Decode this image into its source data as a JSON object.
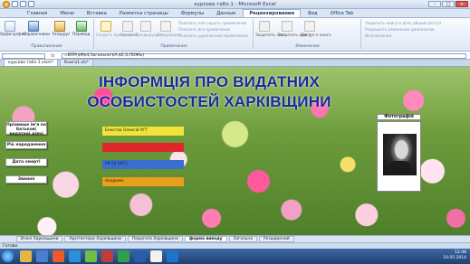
{
  "window": {
    "title": "курсова табл.1 - Microsoft Excel"
  },
  "ribbon_tabs": [
    "Главная",
    "Меню",
    "Вставка",
    "Разметка страницы",
    "Формулы",
    "Данные",
    "Рецензирование",
    "Вид",
    "Office Tab"
  ],
  "active_tab_index": 6,
  "ribbon": {
    "spelling": "Орфография",
    "research": "Справочники",
    "thesaurus": "Тезаурус",
    "translate": "Перевод",
    "proofing_group": "Правописание",
    "comments_group": "Примечания",
    "changes_group": "Изменения",
    "create_note": "Создать примечание",
    "delete": "Удалить",
    "previous": "Предыдущее",
    "next": "Следующее",
    "show_hide": "Показать или скрыть примечание",
    "show_all": "Показать все примечания",
    "show_ink": "Показать рукописные примечания",
    "protect_sheet": "Защитить лист",
    "protect_book": "Защитить книгу",
    "share_book": "Доступ к книге",
    "protect_share": "Защитить книгу и дать общий доступ",
    "allow_ranges": "Разрешить изменение диапазонов",
    "track": "Исправления"
  },
  "formula_bar": {
    "name_box": "",
    "fx": "fx",
    "formula": "=ВПР($M$4;Загальна!$A:$E;3;ЛОЖЬ)"
  },
  "doc_tabs": [
    "курсова табл.1.xlsm*",
    "Книга1.xls*"
  ],
  "active_doc_tab": 0,
  "sheet": {
    "title": "ІНФОРМЦІЯ ПРО ВИДАТНИХ ОСОБИСТОСТЕЙ ХАРКІВЩИНИ",
    "buttons": [
      "Прізвище ім'я по батькові видатної діячі",
      "Рік народження",
      "Дата смерті",
      "Звання"
    ],
    "bars": [
      {
        "text": "Бекетов Олексій М'Т",
        "color": "#f2e33a"
      },
      {
        "text": "",
        "color": "#e0262b"
      },
      {
        "text": "09.02.1871",
        "color": "#3a6fd1"
      },
      {
        "text": "Академік",
        "color": "#e8a01b"
      }
    ],
    "photo_label": "Фотографія"
  },
  "sheet_tabs": [
    "Вчені Харківщини",
    "Архітектори Харківщини",
    "Педагоги Харківщини",
    "форма виводу",
    "Загальна",
    "Розширений"
  ],
  "active_sheet_tab": 3,
  "status": {
    "ready": "Готово"
  },
  "taskbar": {
    "time": "12:48",
    "date": "10.05.2014"
  }
}
